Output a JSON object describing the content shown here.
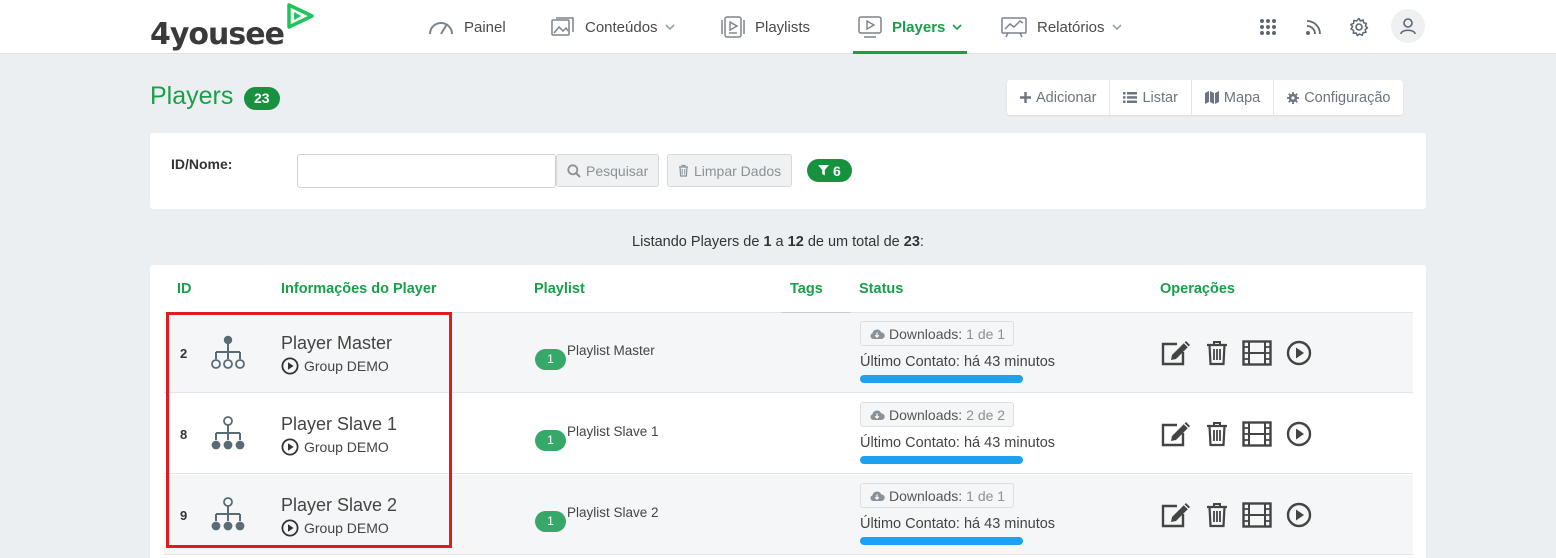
{
  "brand": {
    "logo_text": "4yousee",
    "accent": "#1a9e4a"
  },
  "nav": {
    "items": [
      {
        "label": "Painel",
        "icon": "gauge-icon"
      },
      {
        "label": "Conteúdos",
        "icon": "image-gallery-icon"
      },
      {
        "label": "Playlists",
        "icon": "playlists-icon"
      },
      {
        "label": "Players",
        "icon": "player-screen-icon",
        "active": true
      },
      {
        "label": "Relatórios",
        "icon": "chart-board-icon"
      }
    ],
    "right_icons": [
      "apps-grid-icon",
      "rss-feed-icon",
      "gear-icon",
      "user-icon"
    ]
  },
  "header": {
    "title": "Players",
    "count": "23",
    "actions": [
      "Adicionar",
      "Listar",
      "Mapa",
      "Configuração"
    ]
  },
  "filter": {
    "label": "ID/Nome:",
    "input_value": "",
    "search_label": "Pesquisar",
    "clear_label": "Limpar Dados",
    "filter_count": "6"
  },
  "listing": {
    "prefix": "Listando Players de",
    "from": "1",
    "to_word": "a",
    "to": "12",
    "total_word": "de um total de",
    "total": "23",
    "suffix": ":"
  },
  "table": {
    "headers": {
      "id": "ID",
      "info": "Informações do Player",
      "playlist": "Playlist",
      "tags": "Tags",
      "status": "Status",
      "ops": "Operações"
    },
    "downloads_label": "Downloads:",
    "contact_label": "Último Contato:",
    "rows": [
      {
        "id": "2",
        "name": "Player Master",
        "group": "Group DEMO",
        "playlist_count": "1",
        "playlist": "Playlist Master",
        "downloads": "1 de 1",
        "contact": "há 43 minutos",
        "role": "master"
      },
      {
        "id": "8",
        "name": "Player Slave 1",
        "group": "Group DEMO",
        "playlist_count": "1",
        "playlist": "Playlist Slave 1",
        "downloads": "2 de 2",
        "contact": "há 43 minutos",
        "role": "slave"
      },
      {
        "id": "9",
        "name": "Player Slave 2",
        "group": "Group DEMO",
        "playlist_count": "1",
        "playlist": "Playlist Slave 2",
        "downloads": "1 de 1",
        "contact": "há 43 minutos",
        "role": "slave"
      }
    ]
  },
  "colors": {
    "badge_green": "#18913f",
    "progress_blue": "#1da1ef",
    "highlight_red": "#e01b1b"
  }
}
